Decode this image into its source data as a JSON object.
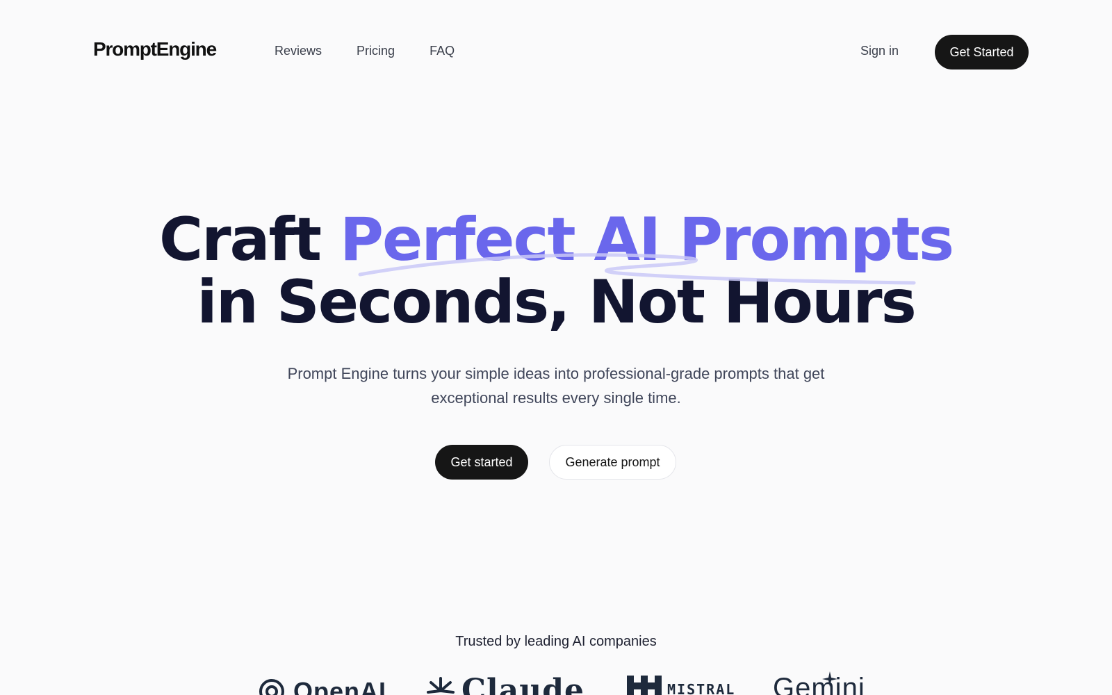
{
  "nav": {
    "logo": "PromptEngine",
    "links": [
      "Reviews",
      "Pricing",
      "FAQ"
    ],
    "sign_in": "Sign in",
    "cta": "Get Started"
  },
  "hero": {
    "title_part1": "Craft ",
    "title_accent": "Perfect AI Prompts",
    "title_line2": "in Seconds, Not Hours",
    "subtitle": "Prompt Engine turns your simple ideas into professional-grade prompts that get exceptional results every single time.",
    "primary_button": "Get started",
    "secondary_button": "Generate prompt"
  },
  "trusted": {
    "heading": "Trusted by leading AI companies",
    "companies": [
      "OpenAI",
      "Claude",
      "MISTRAL",
      "Gemini"
    ]
  },
  "colors": {
    "accent": "#6a67ec",
    "dark": "#161616",
    "background": "#fafafb"
  }
}
